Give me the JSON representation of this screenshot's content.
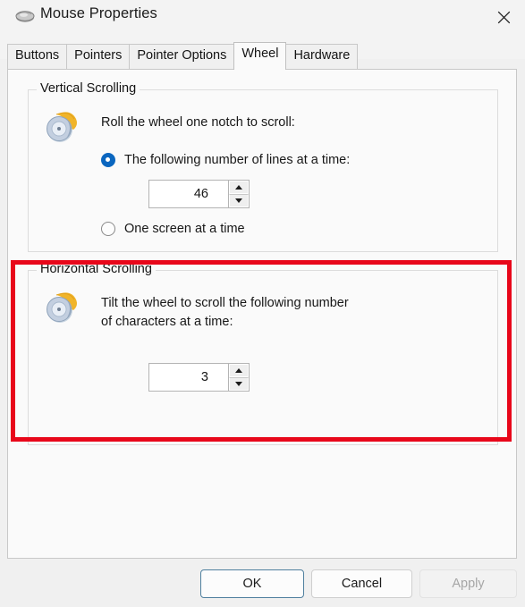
{
  "window": {
    "title": "Mouse Properties",
    "icon": "mouse-icon",
    "close_label": "Close",
    "close_icon": "close-icon"
  },
  "tabs": [
    {
      "label": "Buttons",
      "selected": false
    },
    {
      "label": "Pointers",
      "selected": false
    },
    {
      "label": "Pointer Options",
      "selected": false
    },
    {
      "label": "Wheel",
      "selected": true
    },
    {
      "label": "Hardware",
      "selected": false
    }
  ],
  "vertical_scrolling": {
    "legend": "Vertical Scrolling",
    "icon": "mouse-wheel-icon",
    "description": "Roll the wheel one notch to scroll:",
    "options": [
      {
        "label": "The following number of lines at a time:",
        "checked": true
      },
      {
        "label": "One screen at a time",
        "checked": false
      }
    ],
    "spinner": {
      "value": "46",
      "increment_icon": "arrow-up-icon",
      "decrement_icon": "arrow-down-icon"
    }
  },
  "horizontal_scrolling": {
    "legend": "Horizontal Scrolling",
    "icon": "mouse-wheel-icon",
    "description": "Tilt the wheel to scroll the following number\nof characters at a time:",
    "spinner": {
      "value": "3",
      "increment_icon": "arrow-up-icon",
      "decrement_icon": "arrow-down-icon"
    },
    "highlighted": true,
    "highlight_color": "#e8071a"
  },
  "footer": {
    "ok": "OK",
    "cancel": "Cancel",
    "apply": "Apply",
    "apply_disabled": true
  },
  "colors": {
    "accent": "#0a66bf",
    "window_bg": "#f0f0f0",
    "page_bg": "#fafafa",
    "highlight": "#e8071a",
    "focus_border": "#4f7f9e"
  }
}
